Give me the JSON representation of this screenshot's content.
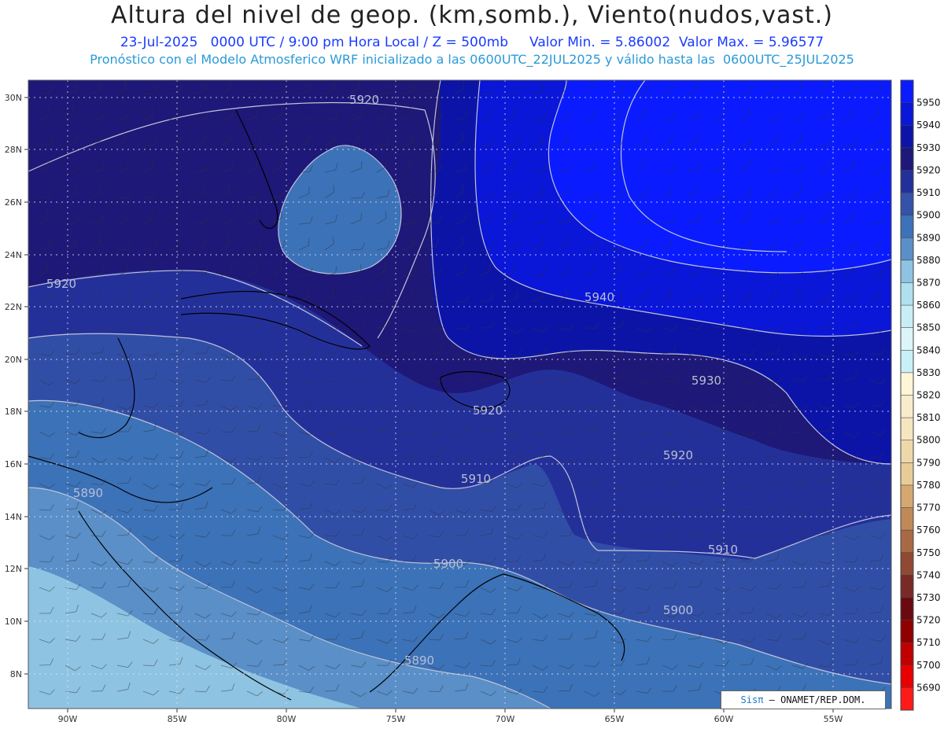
{
  "header": {
    "title": "Altura del nivel de geop. (km,somb.), Viento(nudos,vast.)",
    "subtitle": "23-Jul-2025   0000 UTC / 9:00 pm Hora Local / Z = 500mb     Valor Min. = 5.86002  Valor Max. = 5.96577",
    "info": "Pronóstico con el Modelo Atmosferico WRF inicializado a las 0600UTC_22JUL2025 y válido hasta las  0600UTC_25JUL2025"
  },
  "axes": {
    "lat_labels": [
      "30N",
      "28N",
      "26N",
      "24N",
      "22N",
      "20N",
      "18N",
      "16N",
      "14N",
      "12N",
      "10N",
      "8N"
    ],
    "lon_labels": [
      "90W",
      "85W",
      "80W",
      "75W",
      "70W",
      "65W",
      "60W",
      "55W"
    ]
  },
  "contour_labels": [
    "5920",
    "5920",
    "5940",
    "5930",
    "5920",
    "5920",
    "5910",
    "5890",
    "5900",
    "5910",
    "5900",
    "5890"
  ],
  "colorbar": {
    "labels": [
      "5950",
      "5940",
      "5930",
      "5920",
      "5910",
      "5900",
      "5890",
      "5880",
      "5870",
      "5860",
      "5850",
      "5840",
      "5830",
      "5820",
      "5810",
      "5800",
      "5790",
      "5780",
      "5770",
      "5760",
      "5750",
      "5740",
      "5730",
      "5720",
      "5710",
      "5700",
      "5690"
    ],
    "colors": [
      "#0a1cff",
      "#0a16d8",
      "#0c14a8",
      "#1e1878",
      "#24309a",
      "#3352a8",
      "#3c72b8",
      "#5a8fc8",
      "#8ec3e2",
      "#b0e0ef",
      "#c8eef5",
      "#ddf4f8",
      "#c8f0f8",
      "#fff6d8",
      "#f8eccc",
      "#f5e6c0",
      "#eed8aa",
      "#e8cc98",
      "#d4a870",
      "#c08a58",
      "#a86a44",
      "#904a34",
      "#7a2a26",
      "#6a0a10",
      "#900000",
      "#c00000",
      "#e80000",
      "#ff1a1a"
    ]
  },
  "credit": {
    "brand": "Sisπ",
    "text": "– ONAMET/REP.DOM."
  }
}
